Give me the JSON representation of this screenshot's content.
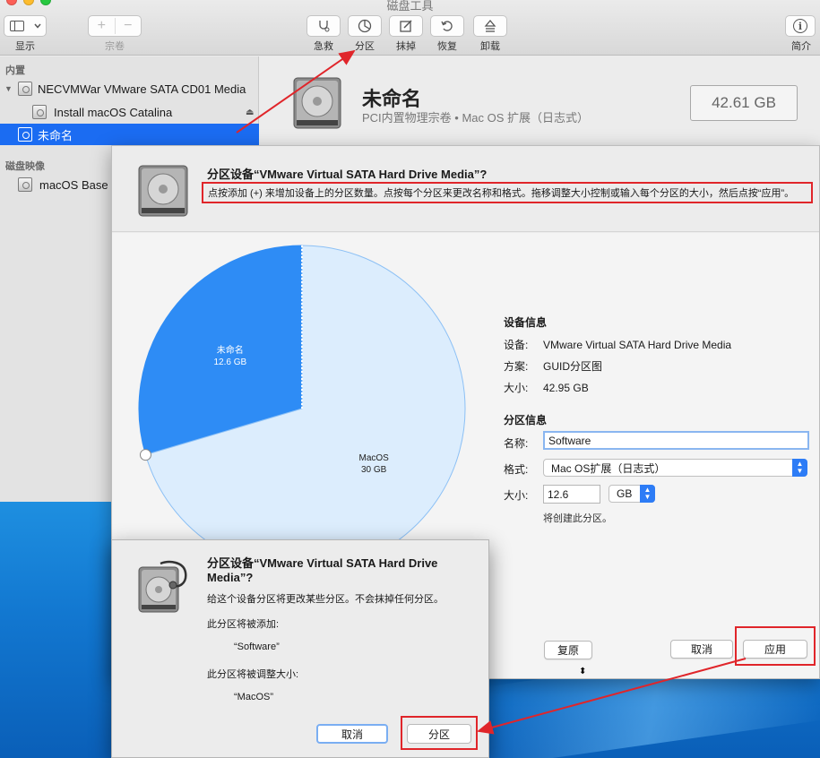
{
  "window": {
    "title": "磁盘工具",
    "traffic_colors": [
      "#fc5f57",
      "#fdbc2e",
      "#27c840"
    ]
  },
  "toolbar": {
    "view_label": "显示",
    "volume_label": "宗卷",
    "volume_add": "+",
    "volume_remove": "−",
    "first_aid_label": "急救",
    "partition_label": "分区",
    "erase_label": "抹掉",
    "restore_label": "恢复",
    "unmount_label": "卸载",
    "info_label": "简介",
    "info_glyph": "i"
  },
  "sidebar": {
    "section_internal": "内置",
    "section_images": "磁盘映像",
    "items": [
      {
        "label": "NECVMWar VMware SATA CD01 Media"
      },
      {
        "label": "Install macOS Catalina"
      },
      {
        "label": "未命名"
      },
      {
        "label": "macOS Base"
      }
    ],
    "eject_glyph": "⏏"
  },
  "main": {
    "volume_name": "未命名",
    "volume_desc": "PCI内置物理宗卷 • Mac OS 扩展（日志式）",
    "volume_size": "42.61 GB"
  },
  "sheet": {
    "title": "分区设备“VMware Virtual SATA Hard Drive Media”?",
    "description": "点按添加 (+) 来增加设备上的分区数量。点按每个分区来更改名称和格式。拖移调整大小控制或输入每个分区的大小，然后点按“应用”。",
    "pie": {
      "slices": [
        {
          "name": "未命名",
          "size": "12.6 GB",
          "value": 12.6,
          "color": "#2e8cf5"
        },
        {
          "name": "MacOS",
          "size": "30 GB",
          "value": 30,
          "color": "#dcedfd"
        }
      ]
    },
    "device_info": {
      "heading": "设备信息",
      "device_key": "设备:",
      "device_val": "VMware Virtual SATA Hard Drive Media",
      "scheme_key": "方案:",
      "scheme_val": "GUID分区图",
      "size_key": "大小:",
      "size_val": "42.95 GB"
    },
    "partition_info": {
      "heading": "分区信息",
      "name_key": "名称:",
      "name_val": "Software",
      "format_key": "格式:",
      "format_val": "Mac OS扩展（日志式）",
      "size_key": "大小:",
      "size_val": "12.6",
      "unit_val": "GB",
      "note": "将创建此分区。"
    },
    "buttons": {
      "revert": "复原",
      "cancel": "取消",
      "apply": "应用"
    }
  },
  "dialog": {
    "title": "分区设备“VMware Virtual SATA Hard Drive Media”?",
    "message": "给这个设备分区将更改某些分区。不会抹掉任何分区。",
    "added_heading": "此分区将被添加:",
    "added_item": "“Software”",
    "resized_heading": "此分区将被调整大小:",
    "resized_item": "“MacOS”",
    "cancel": "取消",
    "partition": "分区"
  },
  "annotation": {
    "color": "#e0252a"
  }
}
